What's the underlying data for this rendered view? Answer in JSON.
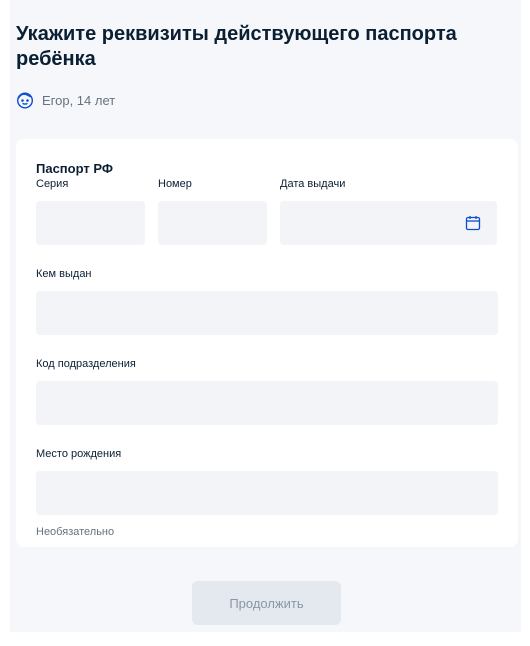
{
  "header": {
    "title": "Укажите реквизиты действующего паспорта ребёнка"
  },
  "child": {
    "icon": "child-face-icon",
    "label": "Егор, 14 лет"
  },
  "form": {
    "section_title": "Паспорт РФ",
    "fields": {
      "serial": {
        "label": "Серия",
        "value": ""
      },
      "number": {
        "label": "Номер",
        "value": ""
      },
      "issue_date": {
        "label": "Дата выдачи",
        "value": "",
        "icon": "calendar-icon"
      },
      "issued_by": {
        "label": "Кем выдан",
        "value": ""
      },
      "division_code": {
        "label": "Код подразделения",
        "value": ""
      },
      "birth_place": {
        "label": "Место рождения",
        "value": "",
        "hint": "Необязательно"
      }
    }
  },
  "actions": {
    "continue_label": "Продолжить"
  },
  "colors": {
    "accent": "#0d4cd3",
    "input_bg": "#f2f4f7",
    "page_bg": "#f5f7fa",
    "button_disabled_bg": "#e4e9f0"
  }
}
